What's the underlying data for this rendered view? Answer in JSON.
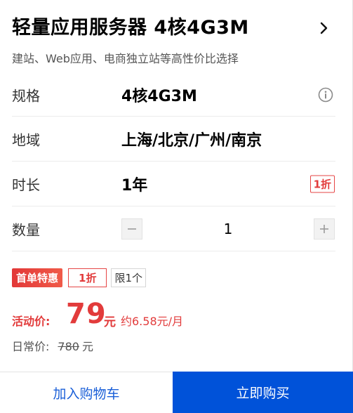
{
  "header": {
    "title": "轻量应用服务器 4核4G3M",
    "subtitle": "建站、Web应用、电商独立站等高性价比选择"
  },
  "icons": {
    "more": "chevron-right-icon",
    "info": "info-circle-icon",
    "minus": "minus-icon",
    "plus": "plus-icon"
  },
  "spec": {
    "label": "规格",
    "value": "4核4G3M"
  },
  "region": {
    "label": "地域",
    "value": "上海/北京/广州/南京"
  },
  "duration": {
    "label": "时长",
    "value": "1年",
    "discount": "1折"
  },
  "quantity": {
    "label": "数量",
    "value": "1"
  },
  "promo": {
    "first_order": "首单特惠",
    "discount": "1折",
    "limit": "限1个"
  },
  "price": {
    "label": "活动价:",
    "value": "79",
    "unit": "元",
    "monthly": "约6.58元/月"
  },
  "regular": {
    "label": "日常价:",
    "value": "780",
    "unit": "元"
  },
  "footer": {
    "cart_label": "加入购物车",
    "buy_label": "立即购买"
  },
  "colors": {
    "accent_red": "#e23b3b",
    "primary_blue": "#0052d9"
  }
}
